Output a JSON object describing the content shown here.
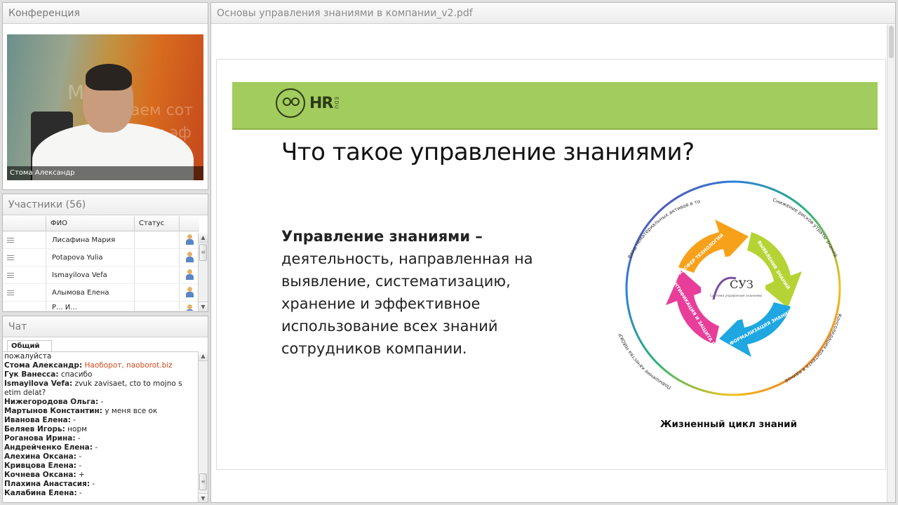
{
  "conference": {
    "title": "Конференция",
    "video_caption": "Стома Александр",
    "video_bg_text_1": "Мы",
    "video_bg_text_2": "аем сот",
    "video_bg_text_3": "нии эф"
  },
  "participants": {
    "title": "Участники (56)",
    "columns": [
      "",
      "ФИО",
      "Статус",
      ""
    ],
    "rows": [
      {
        "name": "Лисафина Мария"
      },
      {
        "name": "Potapova Yulia"
      },
      {
        "name": "Ismayilova Vefa"
      },
      {
        "name": "Алымова Елена"
      },
      {
        "name": "Р... И..."
      }
    ]
  },
  "chat": {
    "title": "Чат",
    "tab": "Общий",
    "messages": [
      {
        "author": "",
        "text": "пожалуйста"
      },
      {
        "author": "Стома Александр:",
        "text": "Наоборот, naoborot.biz",
        "link": true
      },
      {
        "author": "Гук Ванесса:",
        "text": "спасибо"
      },
      {
        "author": "Ismayilova Vefa:",
        "text": "zvuk zavisaet, cto to mojno s etim delat?"
      },
      {
        "author": "Нижегородова Ольга:",
        "text": "-"
      },
      {
        "author": "Мартынов Константин:",
        "text": "у меня все ок"
      },
      {
        "author": "Иванова Елена:",
        "text": "-"
      },
      {
        "author": "Беляев Игорь:",
        "text": "норм"
      },
      {
        "author": "Роганова Ирина:",
        "text": "-"
      },
      {
        "author": "Андрейченко Елена:",
        "text": "-"
      },
      {
        "author": "Алехина Оксана:",
        "text": "-"
      },
      {
        "author": "Кривцова Елена:",
        "text": "-"
      },
      {
        "author": "Кочнева Оксана:",
        "text": "+"
      },
      {
        "author": "Плахина Анастасия:",
        "text": "-"
      },
      {
        "author": "Калабина Елена:",
        "text": "-"
      }
    ]
  },
  "document": {
    "title": "Основы управления знаниями в компании_v2.pdf",
    "slide": {
      "logo_text": "HR",
      "logo_edu": "EDU",
      "title": "Что такое управление знаниями?",
      "definition_term": "Управление знаниями –",
      "definition_text": "деятельность, направленная на выявление, систематизацию, хранение и эффективное использование всех знаний сотрудников компании.",
      "cycle": {
        "center": "СУЗ",
        "center_sub": "Система управления знаниями",
        "arrows": [
          "ТРАНСФЕР ТЕХНОЛОГИИ",
          "ВЫЯВЛЕНИЕ ЗНАНИЙ",
          "ФОРМАЛИЗАЦИЯ ЗНАНИЙ",
          "ИДЕНТИФИКАЦИЯ И ЗАЩИТА РИД"
        ],
        "outer": [
          "Ввод нематериальных активов в товарооборот",
          "Снижение рисков утраты знаний",
          "Консолидация контента в единой СУБД",
          "Повышение качества НИОКР"
        ]
      },
      "caption": "Жизненный цикл знаний"
    }
  },
  "colors": {
    "banner": "#a2cc5d",
    "link": "#d2491e"
  }
}
